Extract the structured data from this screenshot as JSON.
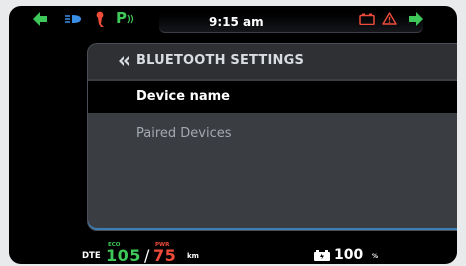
{
  "status_bar": {
    "time": "9:15 am",
    "icons": [
      "left-turn-arrow-icon",
      "headlight-icon",
      "side-stand-icon",
      "park-assist-icon",
      "battery-warning-icon",
      "hazard-warning-icon",
      "right-turn-arrow-icon"
    ],
    "park_label": "P"
  },
  "menu": {
    "title": "BLUETOOTH SETTINGS",
    "back_icon": "double-chevron-left-icon",
    "items": [
      {
        "label": "Device name",
        "selected": true
      },
      {
        "label": "Paired Devices",
        "selected": false
      }
    ]
  },
  "range": {
    "dte_label": "DTE",
    "eco_label": "ECO",
    "eco_value": "105",
    "separator": "/",
    "pwr_label": "PWR",
    "pwr_value": "75",
    "unit": "km"
  },
  "battery": {
    "icon": "battery-icon",
    "value": "100",
    "unit": "%"
  },
  "colors": {
    "green": "#3ec85a",
    "red": "#ef4b3a",
    "blue": "#3a8ee6",
    "panel": "#3a3d42",
    "header": "#2e3034"
  }
}
